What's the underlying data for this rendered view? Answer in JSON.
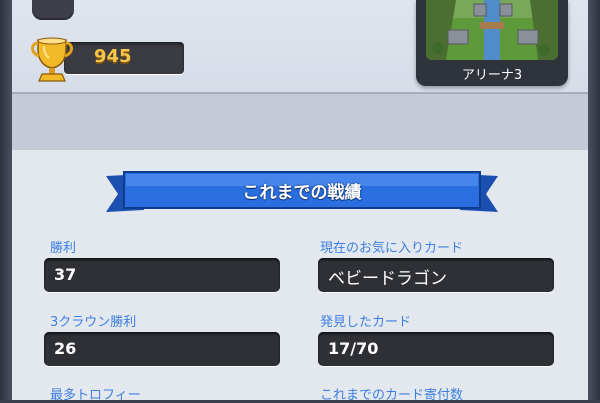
{
  "player": {
    "trophies": "945",
    "arena_name": "アリーナ3"
  },
  "section": {
    "title": "これまでの戦績"
  },
  "stats": {
    "wins": {
      "label": "勝利",
      "value": "37"
    },
    "favorite_card": {
      "label": "現在のお気に入りカード",
      "value": "ベビードラゴン"
    },
    "three_crown_wins": {
      "label": "3クラウン勝利",
      "value": "26"
    },
    "cards_found": {
      "label": "発見したカード",
      "value": "17/70"
    },
    "highest_trophies": {
      "label": "最多トロフィー"
    },
    "cards_donated": {
      "label": "これまでのカード寄付数"
    }
  },
  "colors": {
    "label_blue": "#3d7fe0",
    "trophy_gold": "#f6c64a",
    "ribbon_blue": "#2a6ee0",
    "panel_bg": "#e3e8ef"
  },
  "icons": {
    "trophy": "trophy-icon",
    "arena": "arena-thumbnail"
  }
}
